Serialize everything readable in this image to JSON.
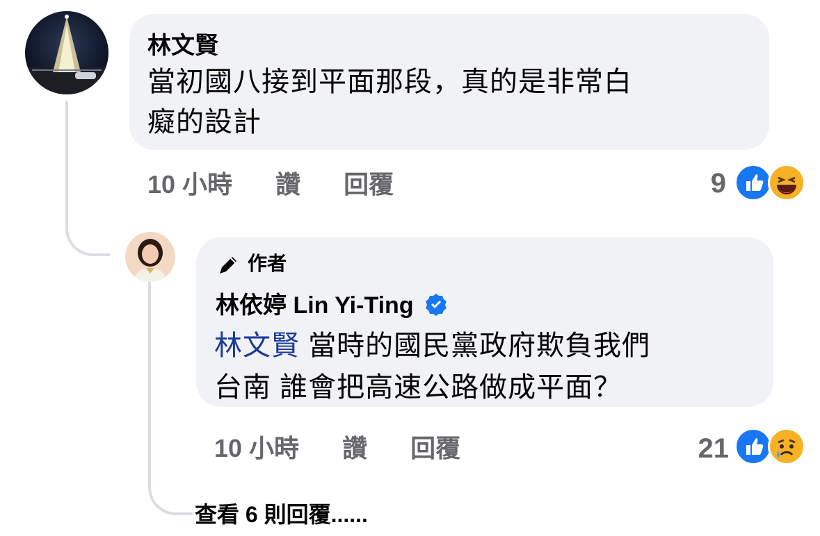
{
  "comment": {
    "author": "林文賢",
    "text_line1": "當初國八接到平面那段，真的是非常白",
    "text_line2": "癡的設計",
    "time": "10 小時",
    "like_label": "讚",
    "reply_label": "回覆",
    "reaction_count": "9",
    "reactions": [
      "like-icon",
      "haha-icon"
    ]
  },
  "reply": {
    "badge_label": "作者",
    "author": "林依婷 Lin Yi-Ting",
    "verified": true,
    "mention": "林文賢",
    "text_line1_rest": " 當時的國民黨政府欺負我們",
    "text_line2": "台南 誰會把高速公路做成平面？",
    "time": "10 小時",
    "like_label": "讚",
    "reply_label": "回覆",
    "reaction_count": "21",
    "reactions": [
      "like-icon",
      "sad-icon"
    ]
  },
  "view_more": "查看 6 則回覆......",
  "colors": {
    "bubble": "#f0f2f5",
    "like_blue": "#1877f2",
    "mention": "#1a3a96",
    "meta_gray": "#65676b"
  }
}
